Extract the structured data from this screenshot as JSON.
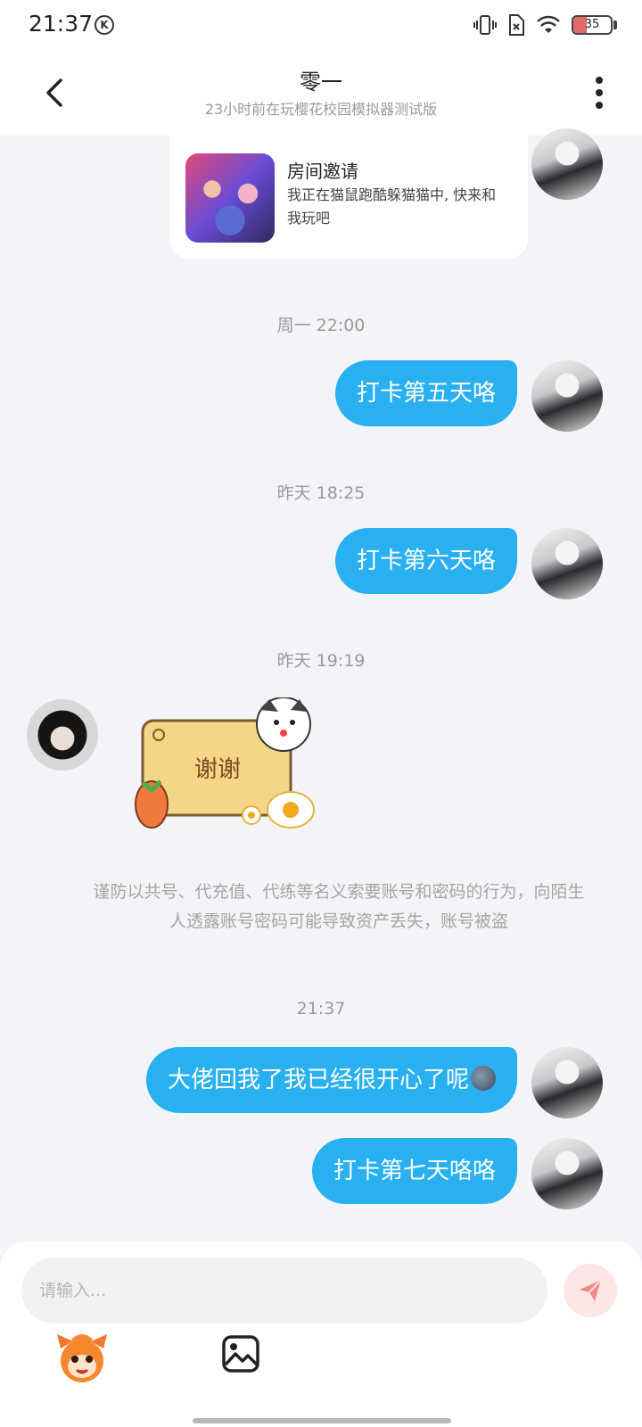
{
  "status_bar": {
    "time": "21:37",
    "k_badge": "K",
    "battery_level": "35",
    "icons": [
      "vibrate-icon",
      "sim-icon",
      "wifi-icon",
      "battery-icon"
    ]
  },
  "header": {
    "title": "零一",
    "subtitle": "23小时前在玩樱花校园模拟器测试版",
    "icons": [
      "back-arrow-icon",
      "more-vertical-icon"
    ]
  },
  "invite_card": {
    "title": "房间邀请",
    "description": "我正在猫鼠跑酷躲猫猫中, 快来和我玩吧"
  },
  "messages": [
    {
      "timestamp": "周一 22:00",
      "text": "打卡第五天咯",
      "from": "self"
    },
    {
      "timestamp": "昨天 18:25",
      "text": "打卡第六天咯",
      "from": "self"
    },
    {
      "timestamp": "昨天 19:19",
      "sticker_text": "谢谢",
      "from": "other"
    },
    {
      "timestamp": "21:37",
      "text": "大佬回我了我已经很开心了呢",
      "emoji": "new-moon-face-icon",
      "from": "self"
    },
    {
      "text": "打卡第七天咯咯",
      "from": "self"
    }
  ],
  "warning": "谨防以共号、代充值、代练等名义索要账号和密码的行为，向陌生人透露账号密码可能导致资产丢失，账号被盗",
  "input": {
    "placeholder": "请输入..."
  },
  "toolbar": {
    "icons": [
      "mascot-emoji-icon",
      "image-icon",
      "send-icon"
    ]
  },
  "colors": {
    "bubble_self": "#29b0f0",
    "background": "#f2f4f7",
    "send_button_bg": "#fde6e6",
    "send_icon": "#f08a8a"
  }
}
